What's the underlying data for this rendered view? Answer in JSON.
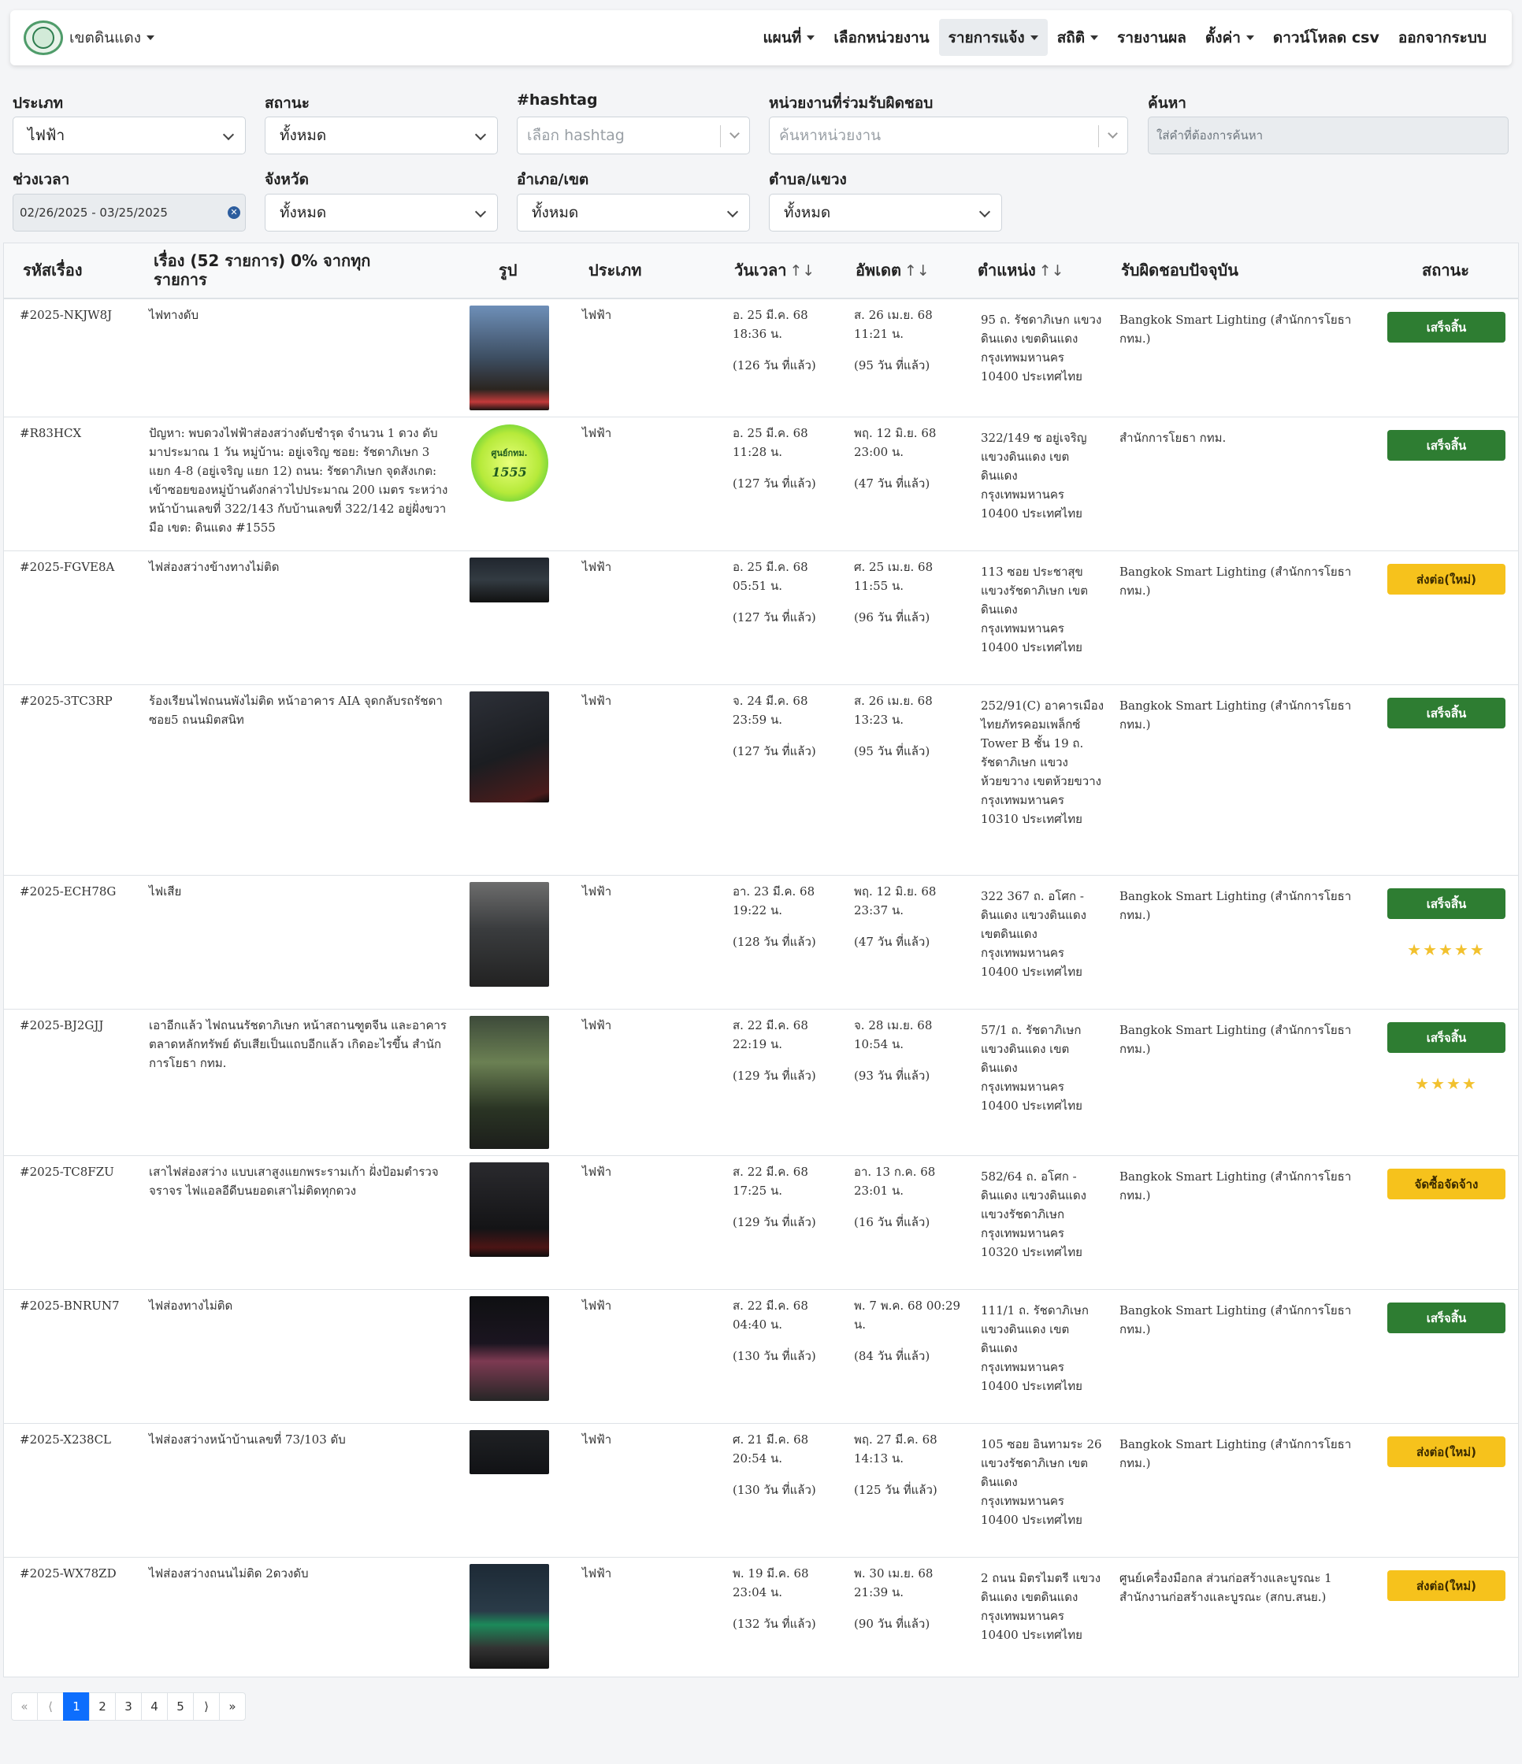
{
  "brand": {
    "name": "เขตดินแดง"
  },
  "nav": [
    "แผนที่",
    "เลือกหน่วยงาน",
    "รายการแจ้ง",
    "สถิติ",
    "รายงานผล",
    "ตั้งค่า",
    "ดาวน์โหลด csv",
    "ออกจากระบบ"
  ],
  "filters": {
    "type_label": "ประเภท",
    "type_value": "ไฟฟ้า",
    "status_label": "สถานะ",
    "status_value": "ทั้งหมด",
    "hashtag_label": "#hashtag",
    "hashtag_placeholder": "เลือก hashtag",
    "agency_label": "หน่วยงานที่ร่วมรับผิดชอบ",
    "agency_placeholder": "ค้นหาหน่วยงาน",
    "search_label": "ค้นหา",
    "search_placeholder": "ใส่คำที่ต้องการค้นหา",
    "period_label": "ช่วงเวลา",
    "period_value": "02/26/2025 - 03/25/2025",
    "province_label": "จังหวัด",
    "province_value": "ทั้งหมด",
    "district_label": "อำเภอ/เขต",
    "district_value": "ทั้งหมด",
    "subdistrict_label": "ตำบล/แขวง",
    "subdistrict_value": "ทั้งหมด"
  },
  "table": {
    "headers": {
      "id": "รหัสเรื่อง",
      "title": "เรื่อง (52 รายการ) 0% จากทุกรายการ",
      "photo": "รูป",
      "type": "ประเภท",
      "datetime": "วันเวลา",
      "updated": "อัพเดต",
      "location": "ตำแหน่ง",
      "responsible": "รับผิดชอบปัจจุบัน",
      "status": "สถานะ",
      "sort_icon": "↑↓"
    },
    "rows": [
      {
        "id": "#2025-NKJW8J",
        "title": "ไฟทางดับ",
        "type": "ไฟฟ้า",
        "date": "อ. 25 มี.ค. 68 18:36 น.",
        "date_ago": "(126 วัน ที่แล้ว)",
        "updated": "ส. 26 เม.ย. 68 11:21 น.",
        "updated_ago": "(95 วัน ที่แล้ว)",
        "location": "95 ถ. รัชดาภิเษก แขวงดินแดง เขตดินแดง กรุงเทพมหานคร 10400 ประเทศไทย",
        "responsible": "Bangkok Smart Lighting (สำนักการโยธา กทม.)",
        "status": "เสร็จสิ้น",
        "status_color": "#2e7d32",
        "stars": ""
      },
      {
        "id": "#R83HCX",
        "title": "ปัญหา: พบดวงไฟฟ้าส่องสว่างดับชำรุด จำนวน 1 ดวง ดับมาประมาณ 1 วัน หมู่บ้าน: อยู่เจริญ ซอย: รัชดาภิเษก 3 แยก 4-8 (อยู่เจริญ แยก 12) ถนน: รัชดาภิเษก จุดสังเกต: เข้าซอยของหมู่บ้านดังกล่าวไปประมาณ 200 เมตร ระหว่างหน้าบ้านเลขที่ 322/143 กับบ้านเลขที่ 322/142 อยู่ฝั่งขวามือ เขต: ดินแดง #1555",
        "type": "ไฟฟ้า",
        "date": "อ. 25 มี.ค. 68 11:28 น.",
        "date_ago": "(127 วัน ที่แล้ว)",
        "updated": "พฤ. 12 มิ.ย. 68 23:00 น.",
        "updated_ago": "(47 วัน ที่แล้ว)",
        "location": "322/149 ซ อยู่เจริญ แขวงดินแดง เขตดินแดง กรุงเทพมหานคร 10400 ประเทศไทย",
        "responsible": "สำนักการโยธา กทม.",
        "status": "เสร็จสิ้น",
        "status_color": "#2e7d32",
        "stars": "",
        "logo_line1": "ศูนย์กทม.",
        "logo_line2": "1555"
      },
      {
        "id": "#2025-FGVE8A",
        "title": "ไฟส่องสว่างข้างทางไม่ติด",
        "type": "ไฟฟ้า",
        "date": "อ. 25 มี.ค. 68 05:51 น.",
        "date_ago": "(127 วัน ที่แล้ว)",
        "updated": "ศ. 25 เม.ย. 68 11:55 น.",
        "updated_ago": "(96 วัน ที่แล้ว)",
        "location": "113 ซอย ประชาสุข แขวงรัชดาภิเษก เขตดินแดง กรุงเทพมหานคร 10400 ประเทศไทย",
        "responsible": "Bangkok Smart Lighting (สำนักการโยธา กทม.)",
        "status": "ส่งต่อ(ใหม่)",
        "status_color": "#f6c21c",
        "stars": ""
      },
      {
        "id": "#2025-3TC3RP",
        "title": "ร้องเรียนไฟถนนพังไม่ติด หน้าอาคาร AIA จุดกลับรถรัชดาซอย5 ถนนมิตสนิท",
        "type": "ไฟฟ้า",
        "date": "จ. 24 มี.ค. 68 23:59 น.",
        "date_ago": "(127 วัน ที่แล้ว)",
        "updated": "ส. 26 เม.ย. 68 13:23 น.",
        "updated_ago": "(95 วัน ที่แล้ว)",
        "location": "252/91(C) อาคารเมืองไทยภัทรคอมเพล็กซ์ Tower B ชั้น 19 ถ. รัชดาภิเษก แขวงห้วยขวาง เขตห้วยขวาง กรุงเทพมหานคร 10310 ประเทศไทย",
        "responsible": "Bangkok Smart Lighting (สำนักการโยธา กทม.)",
        "status": "เสร็จสิ้น",
        "status_color": "#2e7d32",
        "stars": ""
      },
      {
        "id": "#2025-ECH78G",
        "title": "ไฟเสีย",
        "type": "ไฟฟ้า",
        "date": "อา. 23 มี.ค. 68 19:22 น.",
        "date_ago": "(128 วัน ที่แล้ว)",
        "updated": "พฤ. 12 มิ.ย. 68 23:37 น.",
        "updated_ago": "(47 วัน ที่แล้ว)",
        "location": "322 367 ถ. อโศก - ดินแดง แขวงดินแดง เขตดินแดง กรุงเทพมหานคร 10400 ประเทศไทย",
        "responsible": "Bangkok Smart Lighting (สำนักการโยธา กทม.)",
        "status": "เสร็จสิ้น",
        "status_color": "#2e7d32",
        "stars": "★★★★★"
      },
      {
        "id": "#2025-BJ2GJJ",
        "title": "เอาอีกแล้ว ไฟถนนรัชดาภิเษก หน้าสถานฑูตจีน และอาคารตลาดหลักทรัพย์ ดับเสียเป็นแถบอีกแล้ว เกิดอะไรขึ้น สำนักการโยธา กทม.",
        "type": "ไฟฟ้า",
        "date": "ส. 22 มี.ค. 68 22:19 น.",
        "date_ago": "(129 วัน ที่แล้ว)",
        "updated": "จ. 28 เม.ย. 68 10:54 น.",
        "updated_ago": "(93 วัน ที่แล้ว)",
        "location": "57/1 ถ. รัชดาภิเษก แขวงดินแดง เขตดินแดง กรุงเทพมหานคร 10400 ประเทศไทย",
        "responsible": "Bangkok Smart Lighting (สำนักการโยธา กทม.)",
        "status": "เสร็จสิ้น",
        "status_color": "#2e7d32",
        "stars": "★★★★"
      },
      {
        "id": "#2025-TC8FZU",
        "title": "เสาไฟส่องสว่าง แบบเสาสูงแยกพระรามเก้า ฝั่งป้อมตำรวจจราจร ไฟแอลอีดีบนยอดเสาไม่ติดทุกดวง",
        "type": "ไฟฟ้า",
        "date": "ส. 22 มี.ค. 68 17:25 น.",
        "date_ago": "(129 วัน ที่แล้ว)",
        "updated": "อา. 13 ก.ค. 68 23:01 น.",
        "updated_ago": "(16 วัน ที่แล้ว)",
        "location": "582/64 ถ. อโศก - ดินแดง แขวงดินแดง แขวงรัชดาภิเษก กรุงเทพมหานคร 10320 ประเทศไทย",
        "responsible": "Bangkok Smart Lighting (สำนักการโยธา กทม.)",
        "status": "จัดซื้อจัดจ้าง",
        "status_color": "#f6c21c",
        "stars": ""
      },
      {
        "id": "#2025-BNRUN7",
        "title": "ไฟส่องทางไม่ติด",
        "type": "ไฟฟ้า",
        "date": "ส. 22 มี.ค. 68 04:40 น.",
        "date_ago": "(130 วัน ที่แล้ว)",
        "updated": "พ. 7 พ.ค. 68 00:29 น.",
        "updated_ago": "(84 วัน ที่แล้ว)",
        "location": "111/1 ถ. รัชดาภิเษก แขวงดินแดง เขตดินแดง กรุงเทพมหานคร 10400 ประเทศไทย",
        "responsible": "Bangkok Smart Lighting (สำนักการโยธา กทม.)",
        "status": "เสร็จสิ้น",
        "status_color": "#2e7d32",
        "stars": ""
      },
      {
        "id": "#2025-X238CL",
        "title": "ไฟส่องสว่างหน้าบ้านเลขที่ 73/103 ดับ",
        "type": "ไฟฟ้า",
        "date": "ศ. 21 มี.ค. 68 20:54 น.",
        "date_ago": "(130 วัน ที่แล้ว)",
        "updated": "พฤ. 27 มี.ค. 68 14:13 น.",
        "updated_ago": "(125 วัน ที่แล้ว)",
        "location": "105 ซอย อินทามระ 26 แขวงรัชดาภิเษก เขตดินแดง กรุงเทพมหานคร 10400 ประเทศไทย",
        "responsible": "Bangkok Smart Lighting (สำนักการโยธา กทม.)",
        "status": "ส่งต่อ(ใหม่)",
        "status_color": "#f6c21c",
        "stars": ""
      },
      {
        "id": "#2025-WX78ZD",
        "title": "ไฟส่องสว่างถนนไม่ติด 2ดวงดับ",
        "type": "ไฟฟ้า",
        "date": "พ. 19 มี.ค. 68 23:04 น.",
        "date_ago": "(132 วัน ที่แล้ว)",
        "updated": "พ. 30 เม.ย. 68 21:39 น.",
        "updated_ago": "(90 วัน ที่แล้ว)",
        "location": "2 ถนน มิตรไมตรี แขวงดินแดง เขตดินแดง กรุงเทพมหานคร 10400 ประเทศไทย",
        "responsible": "ศูนย์เครื่องมือกล ส่วนก่อสร้างและบูรณะ 1 สำนักงานก่อสร้างและบูรณะ (สกบ.สนย.)",
        "status": "ส่งต่อ(ใหม่)",
        "status_color": "#f6c21c",
        "stars": ""
      }
    ]
  },
  "pagination": {
    "first": "«",
    "prev": "⟨",
    "pages": [
      "1",
      "2",
      "3",
      "4",
      "5"
    ],
    "next": "⟩",
    "last": "»",
    "current": "1"
  }
}
